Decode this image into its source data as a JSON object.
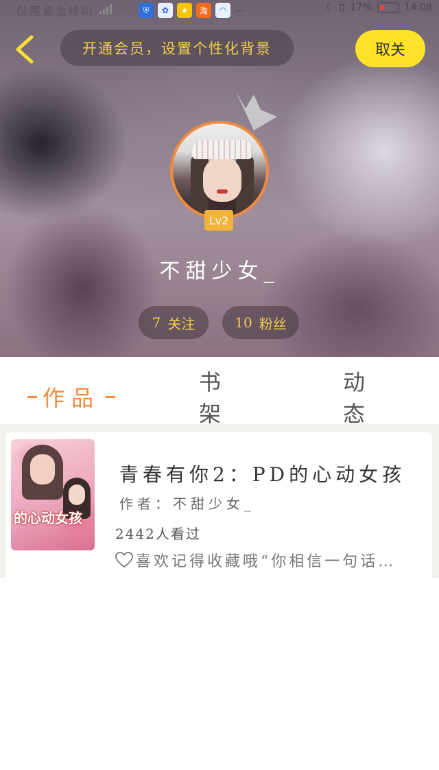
{
  "status_bar": {
    "carrier": "仅限紧急呼叫",
    "battery": "17%",
    "time": "14:08",
    "more": "···"
  },
  "header": {
    "promo": "开通会员，设置个性化背景",
    "cancel": "取关",
    "level": "Lv2",
    "nickname": "不甜少女_",
    "follow_count": "7",
    "follow_label": "关注",
    "fans_count": "10",
    "fans_label": "粉丝"
  },
  "tabs": [
    {
      "label": "作品",
      "active": true
    },
    {
      "label": "书架",
      "active": false
    },
    {
      "label": "动态",
      "active": false
    }
  ],
  "book": {
    "cover_text": "的心动女孩",
    "title": "青春有你2：PD的心动女孩",
    "author": "作者：不甜少女_",
    "views": "2442人看过",
    "desc": "喜欢记得收藏哦“你相信一句话…"
  },
  "colors": {
    "accent": "#f08a3c",
    "yellow": "#ffe22a",
    "gold_text": "#f2d04a"
  }
}
